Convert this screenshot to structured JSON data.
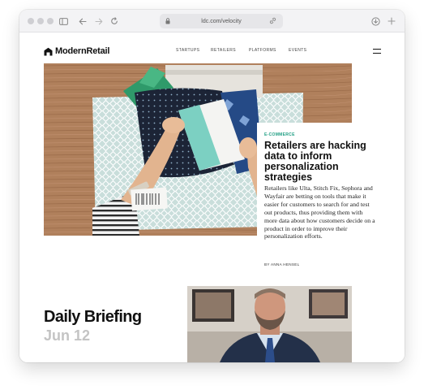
{
  "browser": {
    "url": "ldc.com/velocity",
    "icons": [
      "sidebar-icon",
      "back-icon",
      "forward-icon",
      "reload-icon",
      "lock-icon",
      "share-icon",
      "download-icon",
      "new-tab-icon"
    ]
  },
  "site": {
    "logo_text": "ModernRetail",
    "nav": [
      "STARTUPS",
      "RETAILERS",
      "PLATFORMS",
      "EVENTS"
    ]
  },
  "article": {
    "kicker": "E-COMMERCE",
    "headline": "Retailers are hacking data to inform personalization strategies",
    "dek": "Retailers like Ulta, Stitch Fix, Sephora and Wayfair are betting on tools that make it easier for customers to search for and test out products, thus providing them with more data about how customers decide on a product in order to improve their personalization efforts.",
    "byline": "BY ANNA HENSEL"
  },
  "briefing": {
    "title": "Daily Briefing",
    "date": "Jun 12"
  },
  "colors": {
    "accent": "#1f9e83",
    "text": "#111111",
    "muted": "#c4c4c4"
  }
}
